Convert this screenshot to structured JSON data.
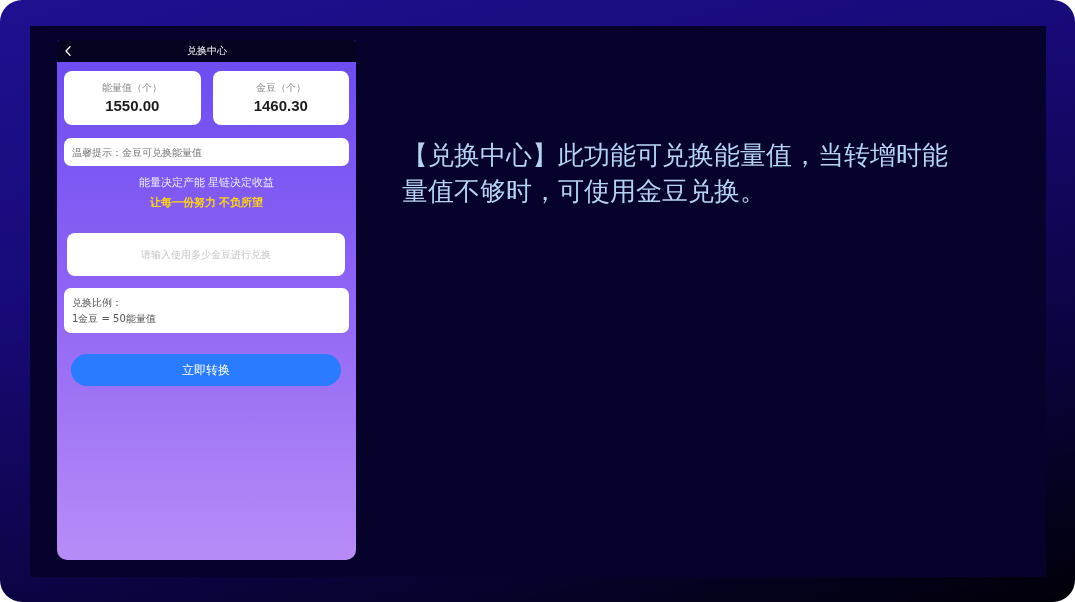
{
  "phone": {
    "header": {
      "title": "兑换中心"
    },
    "balances": [
      {
        "label": "能量值（个）",
        "value": "1550.00"
      },
      {
        "label": "金豆（个）",
        "value": "1460.30"
      }
    ],
    "tip": "温馨提示：金豆可兑换能量值",
    "slogan": "能量决定产能 星链决定收益",
    "motto": "让每一份努力 不负所望",
    "amount_field": {
      "placeholder": "请输入使用多少金豆进行兑换"
    },
    "ratio": {
      "title": "兑换比例：",
      "text": "1金豆 = 50能量值"
    },
    "submit_button": "立即转换"
  },
  "description": "【兑换中心】此功能可兑换能量值，当转增时能量值不够时，可使用金豆兑换。"
}
